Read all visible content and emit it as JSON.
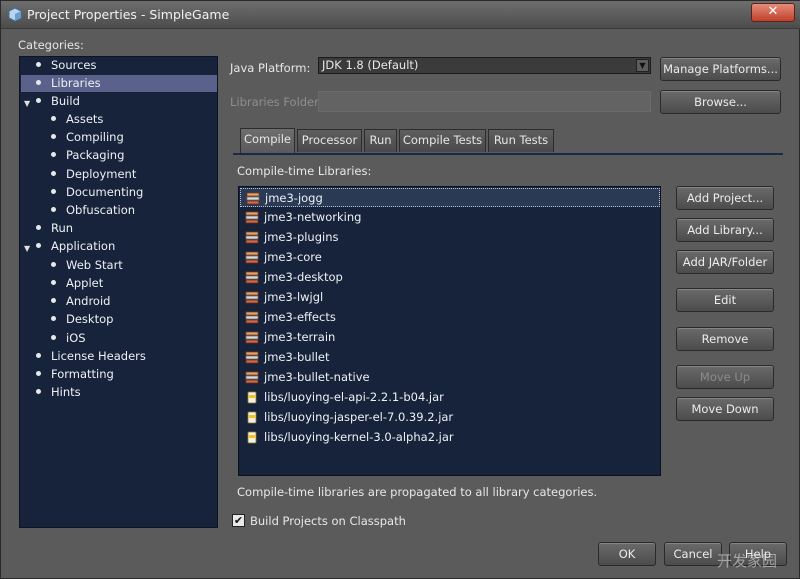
{
  "window": {
    "title": "Project Properties - SimpleGame",
    "close_label": "✕"
  },
  "categories": {
    "label": "Categories:",
    "items": [
      {
        "label": "Sources"
      },
      {
        "label": "Libraries",
        "selected": true
      },
      {
        "label": "Build",
        "expanded": true
      },
      {
        "label": "Assets"
      },
      {
        "label": "Compiling"
      },
      {
        "label": "Packaging"
      },
      {
        "label": "Deployment"
      },
      {
        "label": "Documenting"
      },
      {
        "label": "Obfuscation"
      },
      {
        "label": "Run"
      },
      {
        "label": "Application",
        "expanded": true
      },
      {
        "label": "Web Start"
      },
      {
        "label": "Applet"
      },
      {
        "label": "Android"
      },
      {
        "label": "Desktop"
      },
      {
        "label": "iOS"
      },
      {
        "label": "License Headers"
      },
      {
        "label": "Formatting"
      },
      {
        "label": "Hints"
      }
    ]
  },
  "platform": {
    "label": "Java Platform:",
    "value": "JDK 1.8 (Default)",
    "manage_button": "Manage Platforms...",
    "folder_label": "Libraries Folder:",
    "folder_value": "",
    "browse_button": "Browse..."
  },
  "tabs": [
    {
      "label": "Compile",
      "active": true
    },
    {
      "label": "Processor"
    },
    {
      "label": "Run"
    },
    {
      "label": "Compile Tests"
    },
    {
      "label": "Run Tests"
    }
  ],
  "compile": {
    "list_label": "Compile-time Libraries:",
    "libraries": [
      {
        "name": "jme3-jogg",
        "icon": "library-icon",
        "selected": true
      },
      {
        "name": "jme3-networking",
        "icon": "library-icon"
      },
      {
        "name": "jme3-plugins",
        "icon": "library-icon"
      },
      {
        "name": "jme3-core",
        "icon": "library-icon"
      },
      {
        "name": "jme3-desktop",
        "icon": "library-icon"
      },
      {
        "name": "jme3-lwjgl",
        "icon": "library-icon"
      },
      {
        "name": "jme3-effects",
        "icon": "library-icon"
      },
      {
        "name": "jme3-terrain",
        "icon": "library-icon"
      },
      {
        "name": "jme3-bullet",
        "icon": "library-icon"
      },
      {
        "name": "jme3-bullet-native",
        "icon": "library-icon"
      },
      {
        "name": "libs/luoying-el-api-2.2.1-b04.jar",
        "icon": "jar-icon"
      },
      {
        "name": "libs/luoying-jasper-el-7.0.39.2.jar",
        "icon": "jar-icon"
      },
      {
        "name": "libs/luoying-kernel-3.0-alpha2.jar",
        "icon": "jar-icon"
      }
    ],
    "buttons": {
      "add_project": "Add Project...",
      "add_library": "Add Library...",
      "add_jar": "Add JAR/Folder",
      "edit": "Edit",
      "remove": "Remove",
      "move_up": "Move Up",
      "move_down": "Move Down"
    },
    "note": "Compile-time libraries are propagated to all library categories.",
    "checkbox_label": "Build Projects on Classpath",
    "checkbox_checked": true
  },
  "footer": {
    "ok": "OK",
    "cancel": "Cancel",
    "help": "Help",
    "watermark": "开发家园"
  },
  "colors": {
    "tree_bg": "#16233a",
    "selection": "#5a628c",
    "panel": "#5b5b5b"
  }
}
